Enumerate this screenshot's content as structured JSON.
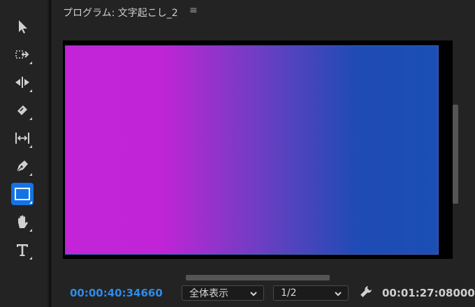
{
  "toolbar": {
    "tools": [
      {
        "name": "selection-tool",
        "icon": "arrow-icon"
      },
      {
        "name": "track-select-tool",
        "icon": "track-select-icon"
      },
      {
        "name": "ripple-edit-tool",
        "icon": "ripple-edit-icon"
      },
      {
        "name": "razor-tool",
        "icon": "razor-icon"
      },
      {
        "name": "slip-tool",
        "icon": "slip-icon"
      },
      {
        "name": "pen-tool",
        "icon": "pen-icon"
      },
      {
        "name": "rectangle-tool",
        "icon": "rectangle-icon",
        "active": true
      },
      {
        "name": "hand-tool",
        "icon": "hand-icon"
      },
      {
        "name": "type-tool",
        "icon": "type-icon"
      }
    ],
    "active_color": "#1473e6"
  },
  "panel": {
    "title": "プログラム: 文字起こし_2",
    "menu_glyph": "≡"
  },
  "controls": {
    "current_timecode": "00:00:40:34660",
    "zoom_select": "全体表示",
    "resolution_select": "1/2",
    "duration_timecode": "00:01:27:08000",
    "timecode_color": "#2d8ceb"
  },
  "video": {
    "gradient_colors": [
      "#c324d8",
      "#8a36c8",
      "#1a4fb3"
    ]
  }
}
